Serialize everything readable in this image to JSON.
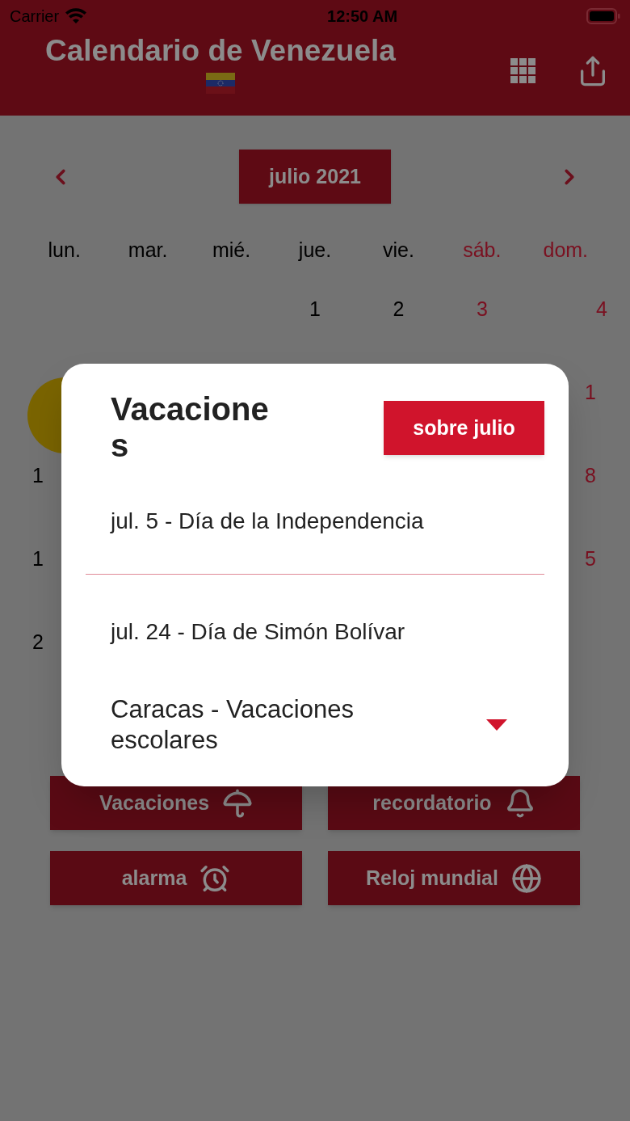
{
  "status_bar": {
    "carrier": "Carrier",
    "time": "12:50 AM"
  },
  "header": {
    "title": "Calendario de Venezuela"
  },
  "month_nav": {
    "label": "julio 2021"
  },
  "weekdays": [
    {
      "label": "lun.",
      "weekend": false
    },
    {
      "label": "mar.",
      "weekend": false
    },
    {
      "label": "mié.",
      "weekend": false
    },
    {
      "label": "jue.",
      "weekend": false
    },
    {
      "label": "vie.",
      "weekend": false
    },
    {
      "label": "sáb.",
      "weekend": true
    },
    {
      "label": "dom.",
      "weekend": true
    }
  ],
  "weeks": [
    {
      "thu": {
        "text": "1",
        "weekend": false
      },
      "fri": {
        "text": "2",
        "weekend": false
      },
      "sat": {
        "text": "3",
        "weekend": true
      },
      "sun": {
        "text": "4",
        "weekend": true
      }
    },
    {
      "mon": {
        "today": true
      },
      "sun": {
        "text": "1",
        "weekend": true
      }
    },
    {
      "mon": {
        "text": "1",
        "weekend": false
      },
      "sun": {
        "text": "8",
        "weekend": true
      }
    },
    {
      "mon": {
        "text": "1",
        "weekend": false
      },
      "sun": {
        "text": "5",
        "weekend": true
      }
    },
    {
      "mon": {
        "text": "2",
        "weekend": false
      }
    }
  ],
  "actions": [
    {
      "label": "Vacaciones",
      "kind": "umbrella"
    },
    {
      "label": "recordatorio",
      "kind": "bell"
    },
    {
      "label": "alarma",
      "kind": "alarm"
    },
    {
      "label": "Reloj mundial",
      "kind": "globe"
    }
  ],
  "dialog": {
    "title": "Vacaciones",
    "button": "sobre julio",
    "holidays": [
      "jul. 5 - Día de la Independencia",
      "jul. 24 - Día de Simón Bolívar"
    ],
    "dropdown": {
      "value": "Caracas - Vacaciones escolares"
    }
  }
}
